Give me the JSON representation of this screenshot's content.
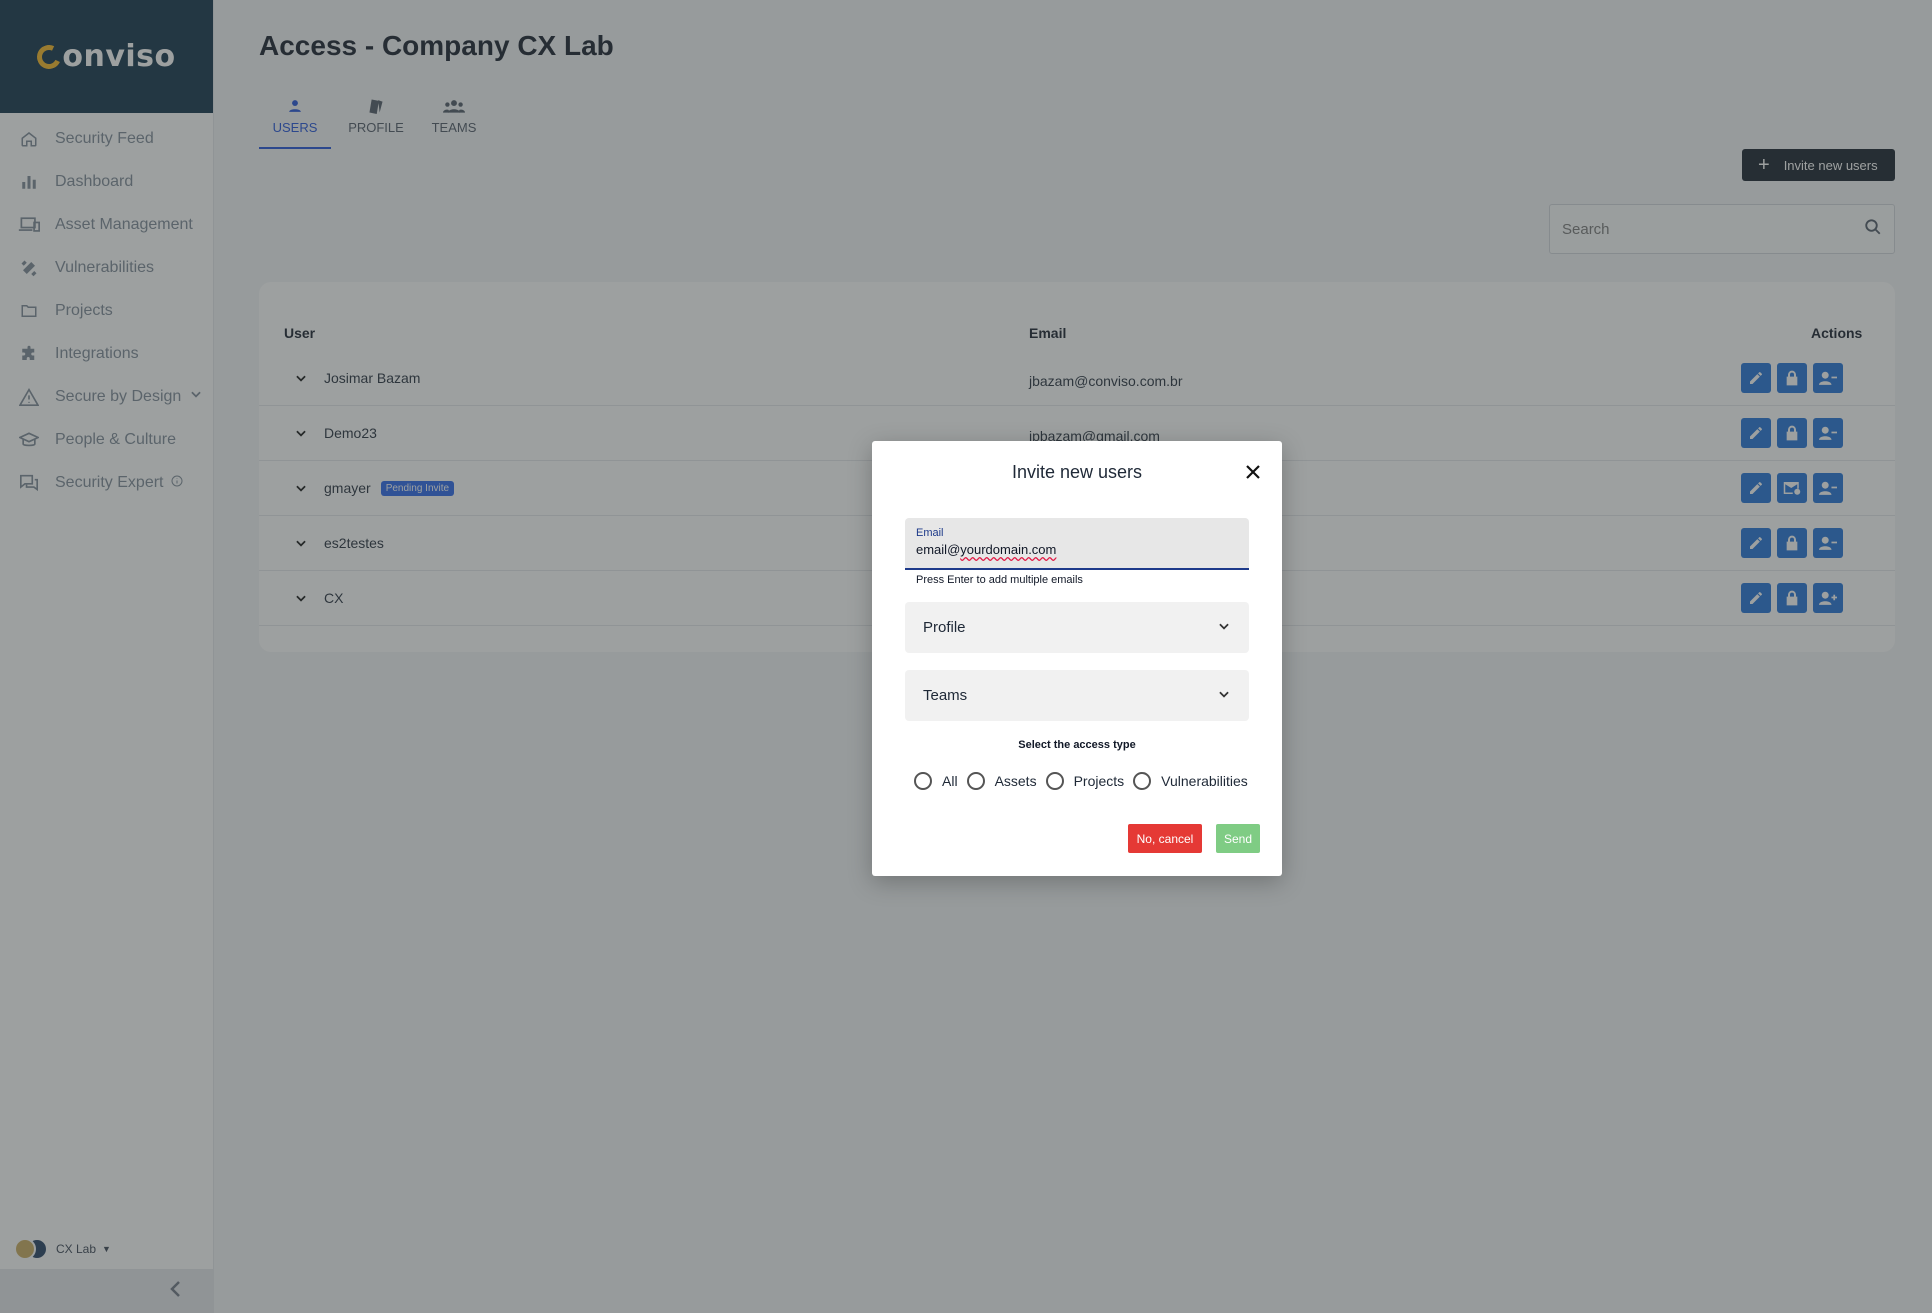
{
  "brand": {
    "logo_text": "onviso",
    "logo_initial": "c"
  },
  "sidebar": {
    "items": [
      {
        "label": "Security Feed",
        "icon": "home-icon"
      },
      {
        "label": "Dashboard",
        "icon": "bar-chart-icon"
      },
      {
        "label": "Asset Management",
        "icon": "devices-icon"
      },
      {
        "label": "Vulnerabilities",
        "icon": "bug-icon"
      },
      {
        "label": "Projects",
        "icon": "folder-icon"
      },
      {
        "label": "Integrations",
        "icon": "puzzle-icon"
      },
      {
        "label": "Secure by Design",
        "icon": "warning-icon"
      },
      {
        "label": "People & Culture",
        "icon": "graduation-cap-icon"
      },
      {
        "label": "Security Expert",
        "icon": "chat-icon"
      }
    ],
    "workspace": "CX Lab"
  },
  "page": {
    "title": "Access - Company CX Lab",
    "tabs": [
      {
        "label": "USERS",
        "active": true
      },
      {
        "label": "PROFILE",
        "active": false
      },
      {
        "label": "TEAMS",
        "active": false
      }
    ],
    "invite_button": "Invite new users",
    "search_placeholder": "Search"
  },
  "table": {
    "columns": {
      "user": "User",
      "email": "Email",
      "actions": "Actions"
    },
    "rows": [
      {
        "user": "Josimar Bazam",
        "email": "jbazam@conviso.com.br",
        "badge": ""
      },
      {
        "user": "Demo23",
        "email": "jpbazam@gmail.com",
        "badge": ""
      },
      {
        "user": "gmayer",
        "email": "",
        "badge": "Pending Invite"
      },
      {
        "user": "es2testes",
        "email": "",
        "badge": ""
      },
      {
        "user": "CX",
        "email": "",
        "badge": ""
      }
    ]
  },
  "modal": {
    "title": "Invite new users",
    "email_label": "Email",
    "email_value_prefix": "email@",
    "email_value_flagged": "yourdomain.com",
    "helper_text": "Press Enter to add multiple emails",
    "profile_label": "Profile",
    "teams_label": "Teams",
    "access_title": "Select the access type",
    "access_options": [
      "All",
      "Assets",
      "Projects",
      "Vulnerabilities"
    ],
    "cancel_label": "No, cancel",
    "send_label": "Send"
  },
  "colors": {
    "sidebar_header": "#0b2d44",
    "accent_blue": "#1d6fd6",
    "cancel_red": "#e53935",
    "send_green": "#7fcc84",
    "invite_button_bg": "#111a26"
  }
}
